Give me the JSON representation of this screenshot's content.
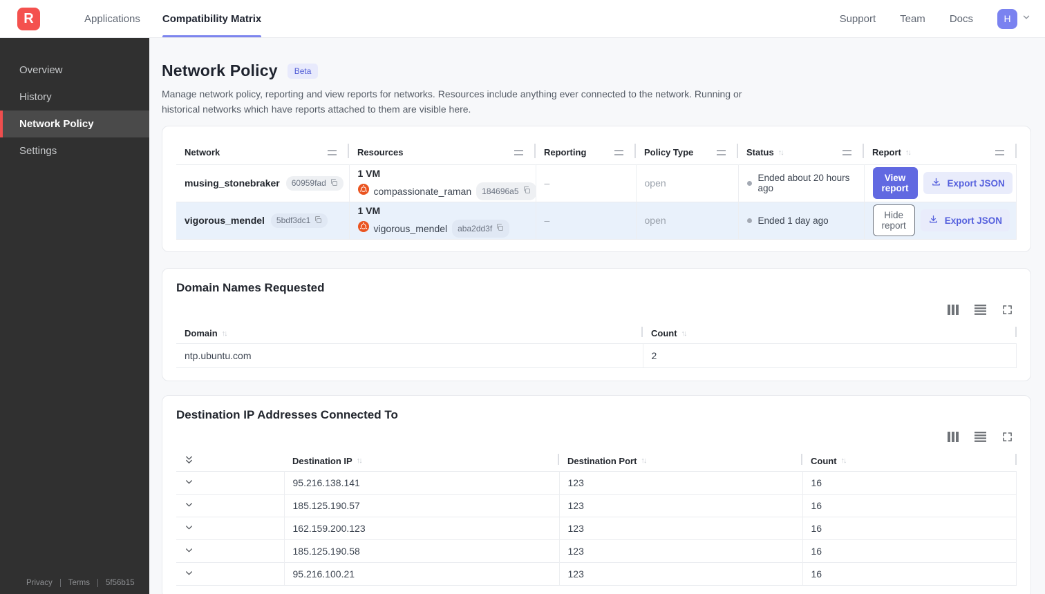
{
  "topnav": {
    "logo_letter": "R",
    "tabs": [
      {
        "label": "Applications"
      },
      {
        "label": "Compatibility Matrix"
      }
    ],
    "links": [
      {
        "label": "Support"
      },
      {
        "label": "Team"
      },
      {
        "label": "Docs"
      }
    ],
    "avatar_letter": "H"
  },
  "sidebar": {
    "items": [
      {
        "label": "Overview"
      },
      {
        "label": "History"
      },
      {
        "label": "Network Policy"
      },
      {
        "label": "Settings"
      }
    ],
    "footer": {
      "privacy": "Privacy",
      "terms": "Terms",
      "version": "5f56b15"
    }
  },
  "page": {
    "title": "Network Policy",
    "badge": "Beta",
    "description": "Manage network policy, reporting and view reports for networks. Resources include anything ever connected to the network. Running or historical networks which have reports attached to them are visible here."
  },
  "icons": {
    "sort": "↑↓"
  },
  "networks_table": {
    "columns": [
      "Network",
      "Resources",
      "Reporting",
      "Policy Type",
      "Status",
      "Report"
    ],
    "rows": [
      {
        "network_name": "musing_stonebraker",
        "network_id": "60959fad",
        "vm_count": "1 VM",
        "resource_name": "compassionate_raman",
        "resource_id": "184696a5",
        "reporting": "–",
        "policy_type": "open",
        "status": "Ended about 20 hours ago",
        "report_button": "View report",
        "export_label": "Export JSON"
      },
      {
        "network_name": "vigorous_mendel",
        "network_id": "5bdf3dc1",
        "vm_count": "1 VM",
        "resource_name": "vigorous_mendel",
        "resource_id": "aba2dd3f",
        "reporting": "–",
        "policy_type": "open",
        "status": "Ended 1 day ago",
        "report_button": "Hide report",
        "export_label": "Export JSON"
      }
    ]
  },
  "domains_card": {
    "title": "Domain Names Requested",
    "columns": [
      "Domain",
      "Count"
    ],
    "rows": [
      {
        "domain": "ntp.ubuntu.com",
        "count": "2"
      }
    ]
  },
  "destinations_card": {
    "title": "Destination IP Addresses Connected To",
    "columns": [
      "Destination IP",
      "Destination Port",
      "Count"
    ],
    "rows": [
      {
        "ip": "95.216.138.141",
        "port": "123",
        "count": "16"
      },
      {
        "ip": "185.125.190.57",
        "port": "123",
        "count": "16"
      },
      {
        "ip": "162.159.200.123",
        "port": "123",
        "count": "16"
      },
      {
        "ip": "185.125.190.58",
        "port": "123",
        "count": "16"
      },
      {
        "ip": "95.216.100.21",
        "port": "123",
        "count": "16"
      }
    ]
  },
  "colors": {
    "brand_red": "#f4514e",
    "accent_indigo": "#6169e1",
    "active_underline": "#7d85ee",
    "selected_row_bg": "#e9f1fb",
    "ubuntu_orange": "#ea5420",
    "status_gray": "#a3a9b3"
  }
}
